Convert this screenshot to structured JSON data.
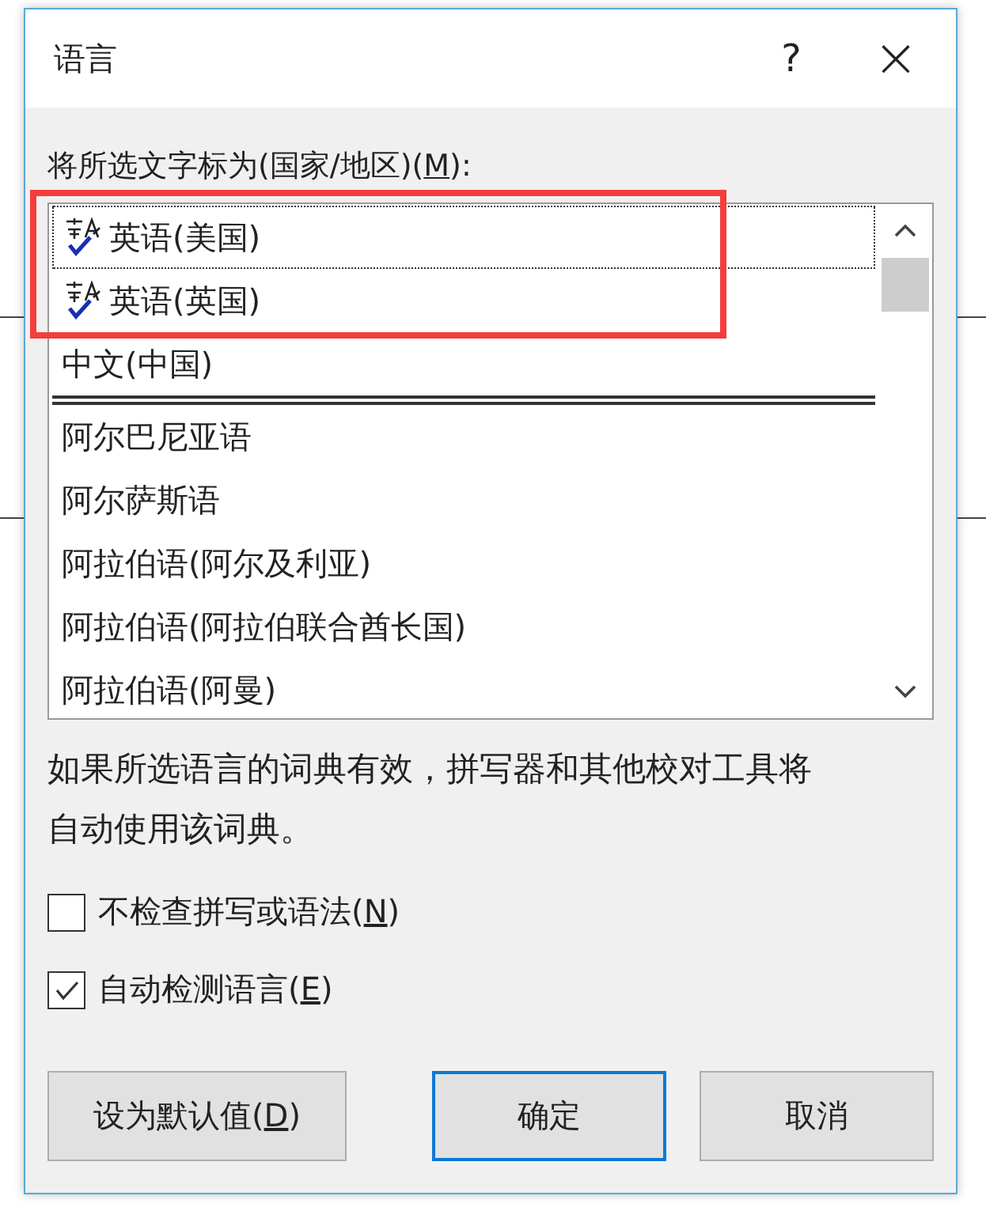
{
  "window": {
    "title": "语言",
    "help": "?",
    "close": "×"
  },
  "list_label": {
    "before": "将所选文字标为(国家/地区)(",
    "key": "M",
    "after": "):"
  },
  "language_list": {
    "highlighted_languages": [
      {
        "name": "英语(美国)",
        "proofing": true,
        "focused": true
      },
      {
        "name": "英语(英国)",
        "proofing": true,
        "focused": false
      }
    ],
    "recent_languages": [
      {
        "name": "中文(中国)",
        "proofing": false,
        "focused": false
      }
    ],
    "all_languages": [
      {
        "name": "阿尔巴尼亚语",
        "proofing": false,
        "focused": false
      },
      {
        "name": "阿尔萨斯语",
        "proofing": false,
        "focused": false
      },
      {
        "name": "阿拉伯语(阿尔及利亚)",
        "proofing": false,
        "focused": false
      },
      {
        "name": "阿拉伯语(阿拉伯联合酋长国)",
        "proofing": false,
        "focused": false
      },
      {
        "name": "阿拉伯语(阿曼)",
        "proofing": false,
        "focused": false
      }
    ]
  },
  "description": "如果所选语言的词典有效，拼写器和其他校对工具将自动使用该词典。",
  "checkboxes": [
    {
      "before": "不检查拼写或语法(",
      "key": "N",
      "after": ")",
      "checked": false
    },
    {
      "before": "自动检测语言(",
      "key": "E",
      "after": ")",
      "checked": true
    }
  ],
  "buttons": [
    {
      "before": "设为默认值(",
      "key": "D",
      "after": ")",
      "default": false
    },
    {
      "before": "确定",
      "default": true
    },
    {
      "before": "取消",
      "default": false
    }
  ]
}
